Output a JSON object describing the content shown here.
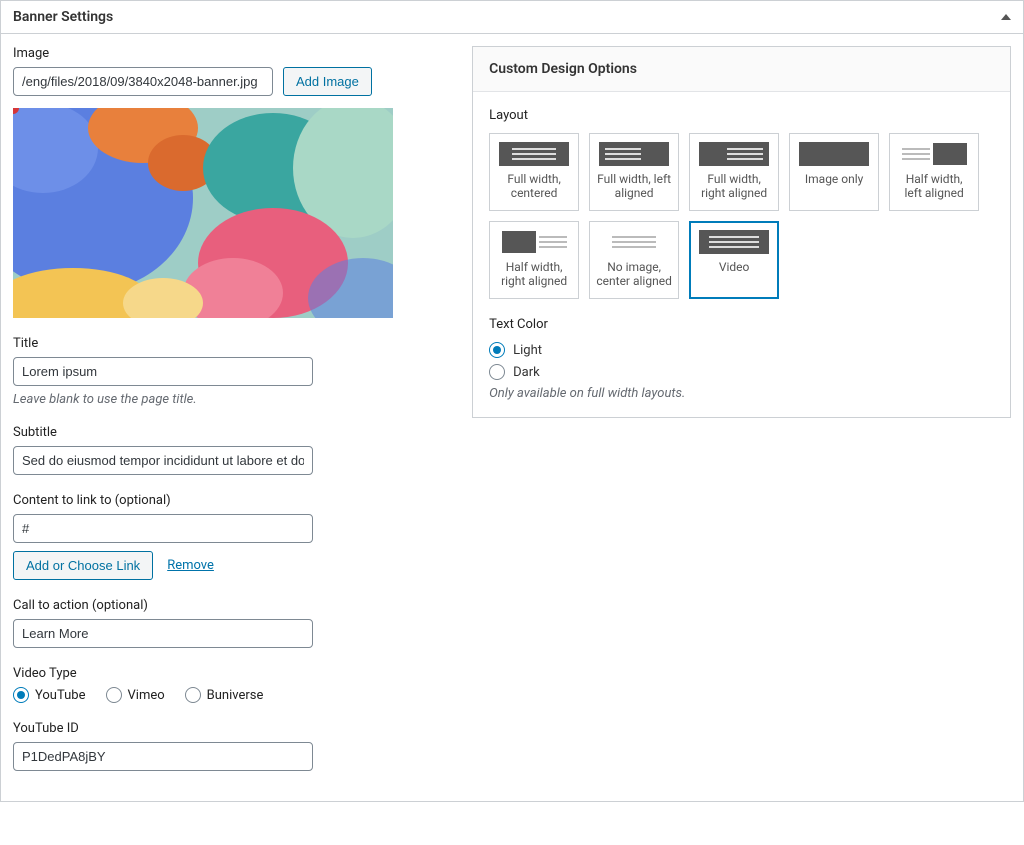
{
  "metabox_title": "Banner Settings",
  "left": {
    "image_label": "Image",
    "image_value": "/eng/files/2018/09/3840x2048-banner.jpg",
    "add_image_label": "Add Image",
    "title_label": "Title",
    "title_value": "Lorem ipsum",
    "title_hint": "Leave blank to use the page title.",
    "subtitle_label": "Subtitle",
    "subtitle_value": "Sed do eiusmod tempor incididunt ut labore et dolore",
    "link_label": "Content to link to (optional)",
    "link_value": "#",
    "add_link_label": "Add or Choose Link",
    "remove_link_label": "Remove",
    "cta_label": "Call to action (optional)",
    "cta_value": "Learn More",
    "video_type_label": "Video Type",
    "video_types": {
      "youtube": "YouTube",
      "vimeo": "Vimeo",
      "buniverse": "Buniverse"
    },
    "video_type_selected": "youtube",
    "youtube_id_label": "YouTube ID",
    "youtube_id_value": "P1DedPA8jBY"
  },
  "right": {
    "panel_title": "Custom Design Options",
    "layout_label": "Layout",
    "layouts": [
      "Full width, centered",
      "Full width, left aligned",
      "Full width, right aligned",
      "Image only",
      "Half width, left aligned",
      "Half width, right aligned",
      "No image, center aligned",
      "Video"
    ],
    "layout_selected": "Video",
    "text_color_label": "Text Color",
    "text_colors": {
      "light": "Light",
      "dark": "Dark"
    },
    "text_color_selected": "light",
    "text_color_hint": "Only available on full width layouts."
  }
}
